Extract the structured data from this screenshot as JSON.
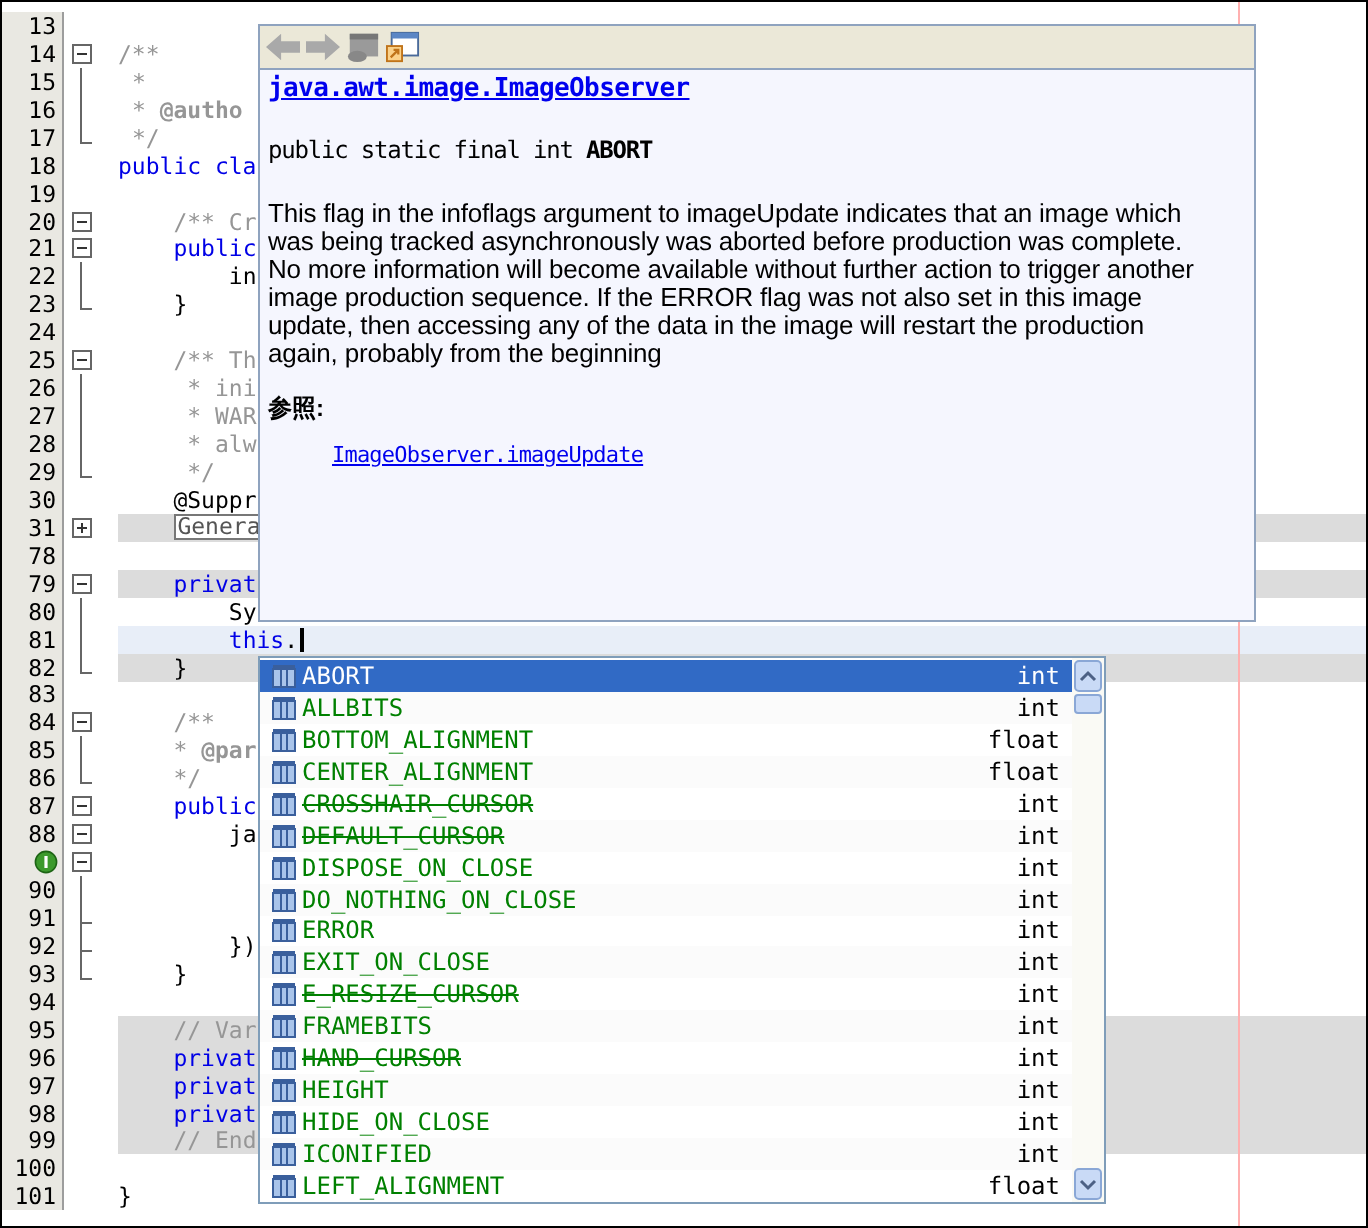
{
  "editor": {
    "lines": [
      {
        "number": "13"
      },
      {
        "number": "14",
        "fold": {
          "kind": "start"
        },
        "tokens": [
          {
            "text": "/**",
            "kind": "comment"
          }
        ]
      },
      {
        "number": "15",
        "fold": {
          "kind": "mid"
        },
        "tokens": [
          {
            "text": " *",
            "kind": "comment"
          }
        ]
      },
      {
        "number": "16",
        "fold": {
          "kind": "mid"
        },
        "tokens": [
          {
            "text": " *",
            "kind": "comment"
          },
          {
            "text": " @autho",
            "kind": "tag"
          }
        ]
      },
      {
        "number": "17",
        "fold": {
          "kind": "end"
        },
        "tokens": [
          {
            "text": " */",
            "kind": "comment"
          }
        ]
      },
      {
        "number": "18",
        "tokens": [
          {
            "text": "public cla",
            "kind": "keyword"
          }
        ]
      },
      {
        "number": "19"
      },
      {
        "number": "20",
        "fold": {
          "kind": "start"
        },
        "tokens": [
          {
            "text": "    /** Cr",
            "kind": "comment"
          }
        ]
      },
      {
        "number": "21",
        "fold": {
          "kind": "start"
        },
        "tokens": [
          {
            "text": "    public",
            "kind": "keyword"
          }
        ]
      },
      {
        "number": "22",
        "fold": {
          "kind": "mid"
        },
        "tokens": [
          {
            "text": "        in",
            "kind": "plain"
          }
        ]
      },
      {
        "number": "23",
        "fold": {
          "kind": "end"
        },
        "tokens": [
          {
            "text": "    }",
            "kind": "plain"
          }
        ]
      },
      {
        "number": "24"
      },
      {
        "number": "25",
        "fold": {
          "kind": "start"
        },
        "tokens": [
          {
            "text": "    /** Th",
            "kind": "comment"
          }
        ]
      },
      {
        "number": "26",
        "fold": {
          "kind": "mid"
        },
        "tokens": [
          {
            "text": "     * ini",
            "kind": "comment"
          }
        ]
      },
      {
        "number": "27",
        "fold": {
          "kind": "mid"
        },
        "tokens": [
          {
            "text": "     * WAR",
            "kind": "comment"
          }
        ]
      },
      {
        "number": "28",
        "fold": {
          "kind": "mid"
        },
        "tokens": [
          {
            "text": "     * alw",
            "kind": "comment"
          }
        ]
      },
      {
        "number": "29",
        "fold": {
          "kind": "end"
        },
        "tokens": [
          {
            "text": "     */",
            "kind": "comment"
          }
        ]
      },
      {
        "number": "30",
        "tokens": [
          {
            "text": "    @Suppr",
            "kind": "plain"
          }
        ]
      },
      {
        "number": "31",
        "fold": {
          "kind": "collapsed"
        },
        "guarded": true,
        "tokens": [
          {
            "text": "    Genera",
            "kind": "folded"
          }
        ]
      },
      {
        "number": "78"
      },
      {
        "number": "79",
        "fold": {
          "kind": "start"
        },
        "guarded": true,
        "tokens": [
          {
            "text": "    privat",
            "kind": "keyword"
          }
        ]
      },
      {
        "number": "80",
        "fold": {
          "kind": "mid"
        },
        "tokens": [
          {
            "text": "        Sy",
            "kind": "plain"
          }
        ]
      },
      {
        "number": "81",
        "fold": {
          "kind": "mid"
        },
        "current": true,
        "caret": true,
        "tokens": [
          {
            "text": "        this",
            "kind": "keyword"
          },
          {
            "text": ".",
            "kind": "plain"
          }
        ]
      },
      {
        "number": "82",
        "fold": {
          "kind": "end"
        },
        "guarded": true,
        "tokens": [
          {
            "text": "    }",
            "kind": "plain"
          }
        ]
      },
      {
        "number": "83"
      },
      {
        "number": "84",
        "fold": {
          "kind": "start"
        },
        "tokens": [
          {
            "text": "    /**",
            "kind": "comment"
          }
        ]
      },
      {
        "number": "85",
        "fold": {
          "kind": "mid"
        },
        "tokens": [
          {
            "text": "    *",
            "kind": "comment"
          },
          {
            "text": " @par",
            "kind": "tag"
          }
        ]
      },
      {
        "number": "86",
        "fold": {
          "kind": "end"
        },
        "tokens": [
          {
            "text": "    */",
            "kind": "comment"
          }
        ]
      },
      {
        "number": "87",
        "fold": {
          "kind": "start"
        },
        "tokens": [
          {
            "text": "    public",
            "kind": "keyword"
          }
        ]
      },
      {
        "number": "88",
        "fold": {
          "kind": "start"
        },
        "tokens": [
          {
            "text": "        ja",
            "kind": "plain"
          }
        ]
      },
      {
        "annotation": true,
        "fold": {
          "kind": "start"
        }
      },
      {
        "number": "90",
        "fold": {
          "kind": "mid"
        }
      },
      {
        "number": "91",
        "fold": {
          "kind": "tee"
        }
      },
      {
        "number": "92",
        "fold": {
          "kind": "tee"
        },
        "tokens": [
          {
            "text": "        })",
            "kind": "plain"
          }
        ]
      },
      {
        "number": "93",
        "fold": {
          "kind": "end"
        },
        "tokens": [
          {
            "text": "    }",
            "kind": "plain"
          }
        ]
      },
      {
        "number": "94"
      },
      {
        "number": "95",
        "guarded": true,
        "tokens": [
          {
            "text": "    // Var",
            "kind": "comment"
          }
        ]
      },
      {
        "number": "96",
        "guarded": true,
        "tokens": [
          {
            "text": "    privat",
            "kind": "keyword"
          }
        ]
      },
      {
        "number": "97",
        "guarded": true,
        "tokens": [
          {
            "text": "    privat",
            "kind": "keyword"
          }
        ]
      },
      {
        "number": "98",
        "guarded": true,
        "tokens": [
          {
            "text": "    privat",
            "kind": "keyword"
          }
        ]
      },
      {
        "number": "99",
        "guarded": true,
        "tokens": [
          {
            "text": "    // End",
            "kind": "comment"
          }
        ]
      },
      {
        "number": "100"
      },
      {
        "number": "101",
        "tokens": [
          {
            "text": "}",
            "kind": "plain"
          }
        ]
      }
    ]
  },
  "javadoc_popup": {
    "toolbar": [
      {
        "kind": "back",
        "disabled": true
      },
      {
        "kind": "forward",
        "disabled": true
      },
      {
        "kind": "source",
        "disabled": true
      },
      {
        "kind": "browser",
        "disabled": false
      }
    ],
    "class_link": "java.awt.image.ImageObserver",
    "signature": "public static final int **ABORT**",
    "description": "This flag in the infoflags argument to imageUpdate indicates that an image which was being tracked asynchronously was aborted before production was complete. No more information will become available without further action to trigger another image production sequence. If the ERROR flag was not also set in this image update, then accessing any of the data in the image will restart the production again, probably from the beginning",
    "see_also_label": "参照:",
    "see_also_links": [
      "ImageObserver.imageUpdate"
    ]
  },
  "completion": {
    "items": [
      {
        "name": "ABORT",
        "type": "int",
        "deprecated": false,
        "selected": true
      },
      {
        "name": "ALLBITS",
        "type": "int",
        "deprecated": false,
        "selected": false
      },
      {
        "name": "BOTTOM_ALIGNMENT",
        "type": "float",
        "deprecated": false,
        "selected": false
      },
      {
        "name": "CENTER_ALIGNMENT",
        "type": "float",
        "deprecated": false,
        "selected": false
      },
      {
        "name": "CROSSHAIR_CURSOR",
        "type": "int",
        "deprecated": true,
        "selected": false
      },
      {
        "name": "DEFAULT_CURSOR",
        "type": "int",
        "deprecated": true,
        "selected": false
      },
      {
        "name": "DISPOSE_ON_CLOSE",
        "type": "int",
        "deprecated": false,
        "selected": false
      },
      {
        "name": "DO_NOTHING_ON_CLOSE",
        "type": "int",
        "deprecated": false,
        "selected": false
      },
      {
        "name": "ERROR",
        "type": "int",
        "deprecated": false,
        "selected": false
      },
      {
        "name": "EXIT_ON_CLOSE",
        "type": "int",
        "deprecated": false,
        "selected": false
      },
      {
        "name": "E_RESIZE_CURSOR",
        "type": "int",
        "deprecated": true,
        "selected": false
      },
      {
        "name": "FRAMEBITS",
        "type": "int",
        "deprecated": false,
        "selected": false
      },
      {
        "name": "HAND_CURSOR",
        "type": "int",
        "deprecated": true,
        "selected": false
      },
      {
        "name": "HEIGHT",
        "type": "int",
        "deprecated": false,
        "selected": false
      },
      {
        "name": "HIDE_ON_CLOSE",
        "type": "int",
        "deprecated": false,
        "selected": false
      },
      {
        "name": "ICONIFIED",
        "type": "int",
        "deprecated": false,
        "selected": false
      },
      {
        "name": "LEFT_ALIGNMENT",
        "type": "float",
        "deprecated": false,
        "selected": false
      }
    ]
  }
}
